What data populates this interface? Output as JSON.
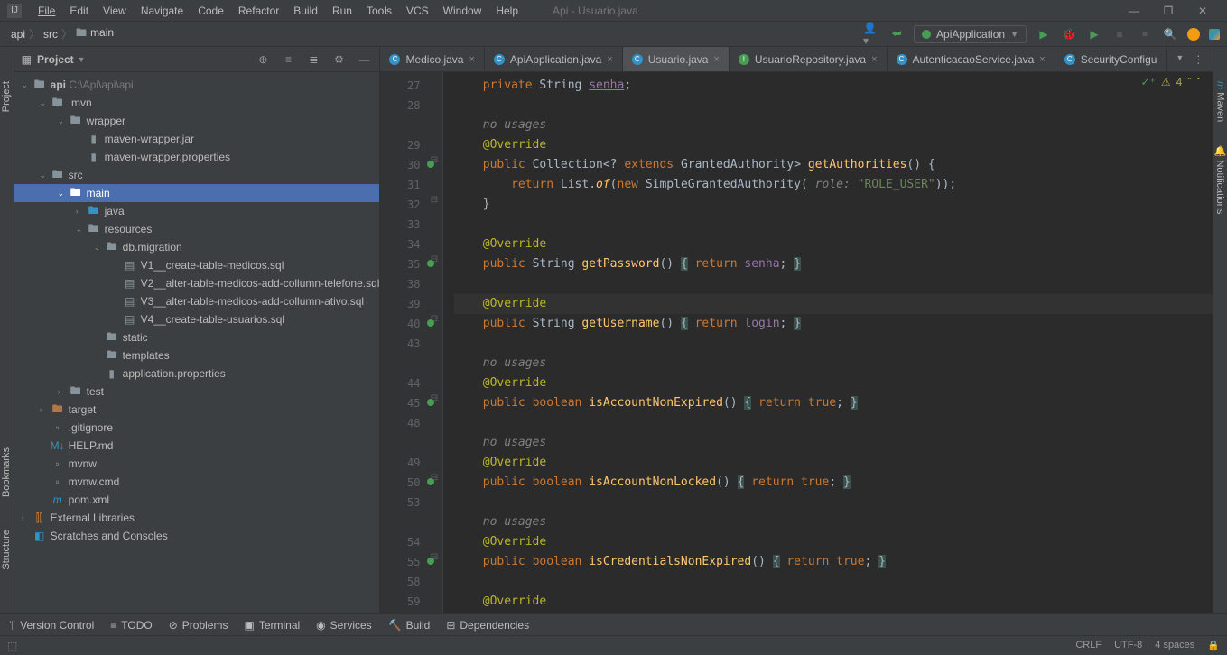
{
  "window": {
    "title": "Api - Usuario.java"
  },
  "menu": {
    "file": "File",
    "edit": "Edit",
    "view": "View",
    "navigate": "Navigate",
    "code": "Code",
    "refactor": "Refactor",
    "build": "Build",
    "run": "Run",
    "tools": "Tools",
    "vcs": "VCS",
    "window": "Window",
    "help": "Help"
  },
  "breadcrumbs": {
    "a": "api",
    "b": "src",
    "c": "main"
  },
  "runconfig": {
    "name": "ApiApplication"
  },
  "panel": {
    "title": "Project"
  },
  "tooltabs": {
    "project": "Project",
    "bookmarks": "Bookmarks",
    "structure": "Structure",
    "maven": "Maven",
    "notifications": "Notifications"
  },
  "tree": {
    "root": "api",
    "rootpath": "C:\\Api\\api\\api",
    "mvn": ".mvn",
    "wrapper": "wrapper",
    "mwjar": "maven-wrapper.jar",
    "mwprops": "maven-wrapper.properties",
    "src": "src",
    "main": "main",
    "java": "java",
    "resources": "resources",
    "dbmig": "db.migration",
    "v1": "V1__create-table-medicos.sql",
    "v2": "V2__alter-table-medicos-add-collumn-telefone.sql",
    "v3": "V3__alter-table-medicos-add-collumn-ativo.sql",
    "v4": "V4__create-table-usuarios.sql",
    "static": "static",
    "templates": "templates",
    "appprops": "application.properties",
    "test": "test",
    "target": "target",
    "gitignore": ".gitignore",
    "helpmd": "HELP.md",
    "mvnw": "mvnw",
    "mvnwcmd": "mvnw.cmd",
    "pom": "pom.xml",
    "extlib": "External Libraries",
    "scratches": "Scratches and Consoles"
  },
  "tabs": {
    "t0": "Medico.java",
    "t1": "ApiApplication.java",
    "t2": "Usuario.java",
    "t3": "UsuarioRepository.java",
    "t4": "AutenticacaoService.java",
    "t5": "SecurityConfigu"
  },
  "editor": {
    "warn_count": "4",
    "lines": [
      "27",
      "28",
      "",
      "29",
      "30",
      "31",
      "32",
      "33",
      "34",
      "35",
      "38",
      "39",
      "40",
      "43",
      "",
      "44",
      "45",
      "48",
      "",
      "49",
      "50",
      "53",
      "",
      "54",
      "55",
      "58",
      "59"
    ],
    "c": {
      "no_usages": "no usages",
      "override": "@Override",
      "private": "private",
      "public": "public",
      "return": "return",
      "extends": "extends",
      "new": "new",
      "string": "String",
      "boolean": "boolean",
      "collection": "Collection",
      "true": "true",
      "senha": "senha",
      "login": "login",
      "role": "role:",
      "roleuser": "\"ROLE_USER\"",
      "getAuthorities": "getAuthorities",
      "getPassword": "getPassword",
      "getUsername": "getUsername",
      "isAccountNonExpired": "isAccountNonExpired",
      "isAccountNonLocked": "isAccountNonLocked",
      "isCredentialsNonExpired": "isCredentialsNonExpired",
      "GrantedAuthority": "GrantedAuthority",
      "List": "List",
      "of": "of",
      "SimpleGrantedAuthority": "SimpleGrantedAuthority"
    }
  },
  "status": {
    "vc": "Version Control",
    "todo": "TODO",
    "problems": "Problems",
    "terminal": "Terminal",
    "services": "Services",
    "build": "Build",
    "deps": "Dependencies",
    "crlf": "CRLF",
    "enc": "UTF-8",
    "indent": "4 spaces"
  }
}
